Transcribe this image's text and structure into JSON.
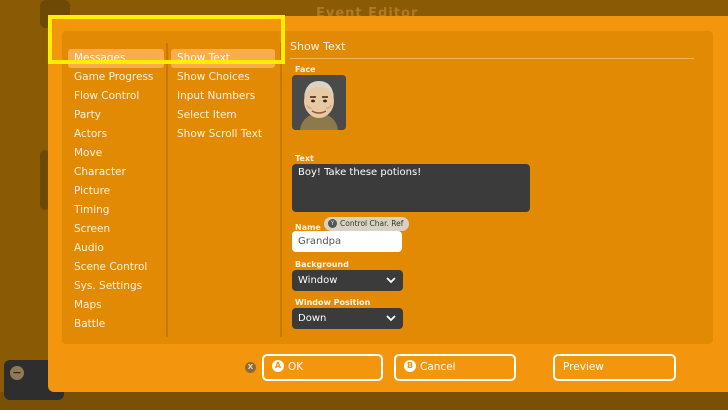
{
  "window_title": "Event Editor",
  "categories": [
    "Messages",
    "Game Progress",
    "Flow Control",
    "Party",
    "Actors",
    "Move",
    "Character",
    "Picture",
    "Timing",
    "Screen",
    "Audio",
    "Scene Control",
    "Sys. Settings",
    "Maps",
    "Battle"
  ],
  "subcommands": [
    "Show Text",
    "Show Choices",
    "Input Numbers",
    "Select Item",
    "Show Scroll Text"
  ],
  "detail": {
    "title": "Show Text",
    "face_label": "Face",
    "text_label": "Text",
    "text_value": "Boy! Take these potions!",
    "control_char_button": "Y",
    "control_char_label": "Control Char. Ref",
    "name_label": "Name",
    "name_value": "Grandpa",
    "background_label": "Background",
    "background_value": "Window",
    "window_position_label": "Window Position",
    "window_position_value": "Down"
  },
  "footer": {
    "x_hint": "X",
    "ok_button_glyph": "A",
    "ok_label": "OK",
    "cancel_button_glyph": "B",
    "cancel_label": "Cancel",
    "preview_label": "Preview"
  },
  "background_minus_glyph": "−",
  "colors": {
    "modal_bg": "#f3950d",
    "panel_bg": "#e38a05",
    "selected_item": "#f9ad4b",
    "highlight": "#ffee00",
    "field_dark": "#3b3b3b"
  }
}
